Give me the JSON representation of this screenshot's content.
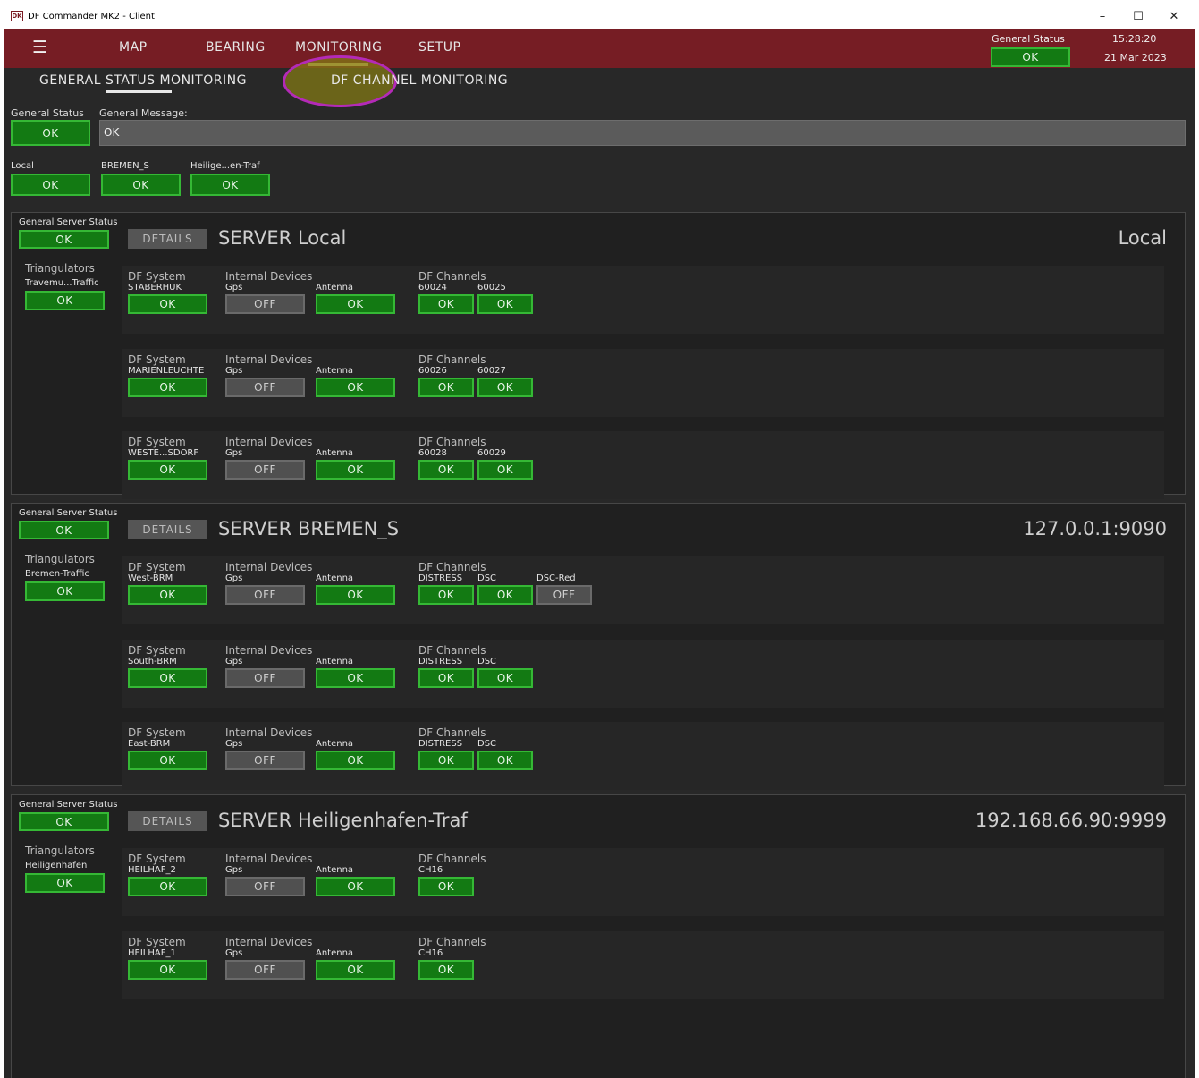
{
  "window": {
    "title": "DF Commander MK2 - Client",
    "icon_text": "DK",
    "minimize": "–",
    "maximize": "☐",
    "close": "✕"
  },
  "nav": {
    "menu_icon": "☰",
    "items": [
      "MAP",
      "BEARING",
      "MONITORING",
      "SETUP"
    ],
    "status_label": "General Status",
    "status_value": "OK",
    "time": "15:28:20",
    "date": "21 Mar 2023"
  },
  "subtabs": [
    "GENERAL STATUS MONITORING",
    "DF CHANNEL MONITORING"
  ],
  "general": {
    "status_label": "General Status",
    "status_value": "OK",
    "message_label": "General Message:",
    "message_value": "OK",
    "servers": [
      {
        "label": "Local",
        "value": "OK"
      },
      {
        "label": "BREMEN_S",
        "value": "OK"
      },
      {
        "label": "Heilige...en-Traf",
        "value": "OK"
      }
    ]
  },
  "common": {
    "server_status_label": "General Server Status",
    "details_label": "DETAILS",
    "triangulators_label": "Triangulators",
    "df_system_label": "DF System",
    "internal_devices_label": "Internal Devices",
    "gps_label": "Gps",
    "antenna_label": "Antenna",
    "df_channels_label": "DF Channels"
  },
  "servers": [
    {
      "status": "OK",
      "title": "SERVER Local",
      "address": "Local",
      "triangulator": {
        "name": "Travemu...Traffic",
        "value": "OK"
      },
      "systems": [
        {
          "name": "STABERHUK",
          "system": "OK",
          "gps": "OFF",
          "antenna": "OK",
          "channels": [
            {
              "name": "60024",
              "value": "OK"
            },
            {
              "name": "60025",
              "value": "OK"
            }
          ]
        },
        {
          "name": "MARIENLEUCHTE",
          "system": "OK",
          "gps": "OFF",
          "antenna": "OK",
          "channels": [
            {
              "name": "60026",
              "value": "OK"
            },
            {
              "name": "60027",
              "value": "OK"
            }
          ]
        },
        {
          "name": "WESTE...SDORF",
          "system": "OK",
          "gps": "OFF",
          "antenna": "OK",
          "channels": [
            {
              "name": "60028",
              "value": "OK"
            },
            {
              "name": "60029",
              "value": "OK"
            }
          ]
        }
      ]
    },
    {
      "status": "OK",
      "title": "SERVER BREMEN_S",
      "address": "127.0.0.1:9090",
      "triangulator": {
        "name": "Bremen-Traffic",
        "value": "OK"
      },
      "systems": [
        {
          "name": "West-BRM",
          "system": "OK",
          "gps": "OFF",
          "antenna": "OK",
          "channels": [
            {
              "name": "DISTRESS",
              "value": "OK"
            },
            {
              "name": "DSC",
              "value": "OK"
            },
            {
              "name": "DSC-Red",
              "value": "OFF"
            }
          ]
        },
        {
          "name": "South-BRM",
          "system": "OK",
          "gps": "OFF",
          "antenna": "OK",
          "channels": [
            {
              "name": "DISTRESS",
              "value": "OK"
            },
            {
              "name": "DSC",
              "value": "OK"
            }
          ]
        },
        {
          "name": "East-BRM",
          "system": "OK",
          "gps": "OFF",
          "antenna": "OK",
          "channels": [
            {
              "name": "DISTRESS",
              "value": "OK"
            },
            {
              "name": "DSC",
              "value": "OK"
            }
          ]
        }
      ]
    },
    {
      "status": "OK",
      "title": "SERVER Heiligenhafen-Traf",
      "address": "192.168.66.90:9999",
      "triangulator": {
        "name": "Heiligenhafen",
        "value": "OK"
      },
      "systems": [
        {
          "name": "HEILHAF_2",
          "system": "OK",
          "gps": "OFF",
          "antenna": "OK",
          "channels": [
            {
              "name": "CH16",
              "value": "OK"
            }
          ]
        },
        {
          "name": "HEILHAF_1",
          "system": "OK",
          "gps": "OFF",
          "antenna": "OK",
          "channels": [
            {
              "name": "CH16",
              "value": "OK"
            }
          ]
        }
      ]
    }
  ],
  "colors": {
    "nav_background": "#761d24",
    "ok_green": "#137a13",
    "off_grey": "#505050",
    "highlight_ring": "#b42ab8"
  }
}
